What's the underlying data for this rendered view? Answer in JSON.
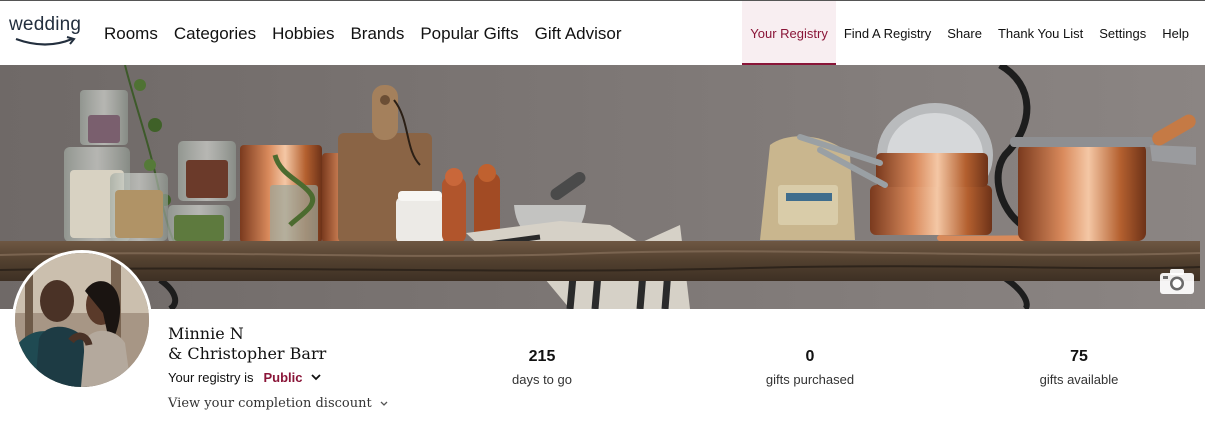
{
  "logo": {
    "text": "wedding"
  },
  "nav_left": [
    "Rooms",
    "Categories",
    "Hobbies",
    "Brands",
    "Popular Gifts",
    "Gift Advisor"
  ],
  "nav_right": [
    "Your Registry",
    "Find A Registry",
    "Share",
    "Thank You List",
    "Settings",
    "Help"
  ],
  "active_tab": "Your Registry",
  "couple": {
    "line1": "Minnie N",
    "line2": "& Christopher Barr"
  },
  "visibility": {
    "label": "Your registry is",
    "status": "Public"
  },
  "discount_link": "View your completion discount",
  "stats": [
    {
      "value": "215",
      "label": "days to go"
    },
    {
      "value": "0",
      "label": "gifts purchased"
    },
    {
      "value": "75",
      "label": "gifts available"
    }
  ],
  "colors": {
    "accent": "#8a1538",
    "active_bg": "#f8eef1",
    "shelf": "#5b4634",
    "wall": "#777270"
  },
  "icons": {
    "camera": "camera-icon",
    "chevron": "chevron-down-icon"
  }
}
